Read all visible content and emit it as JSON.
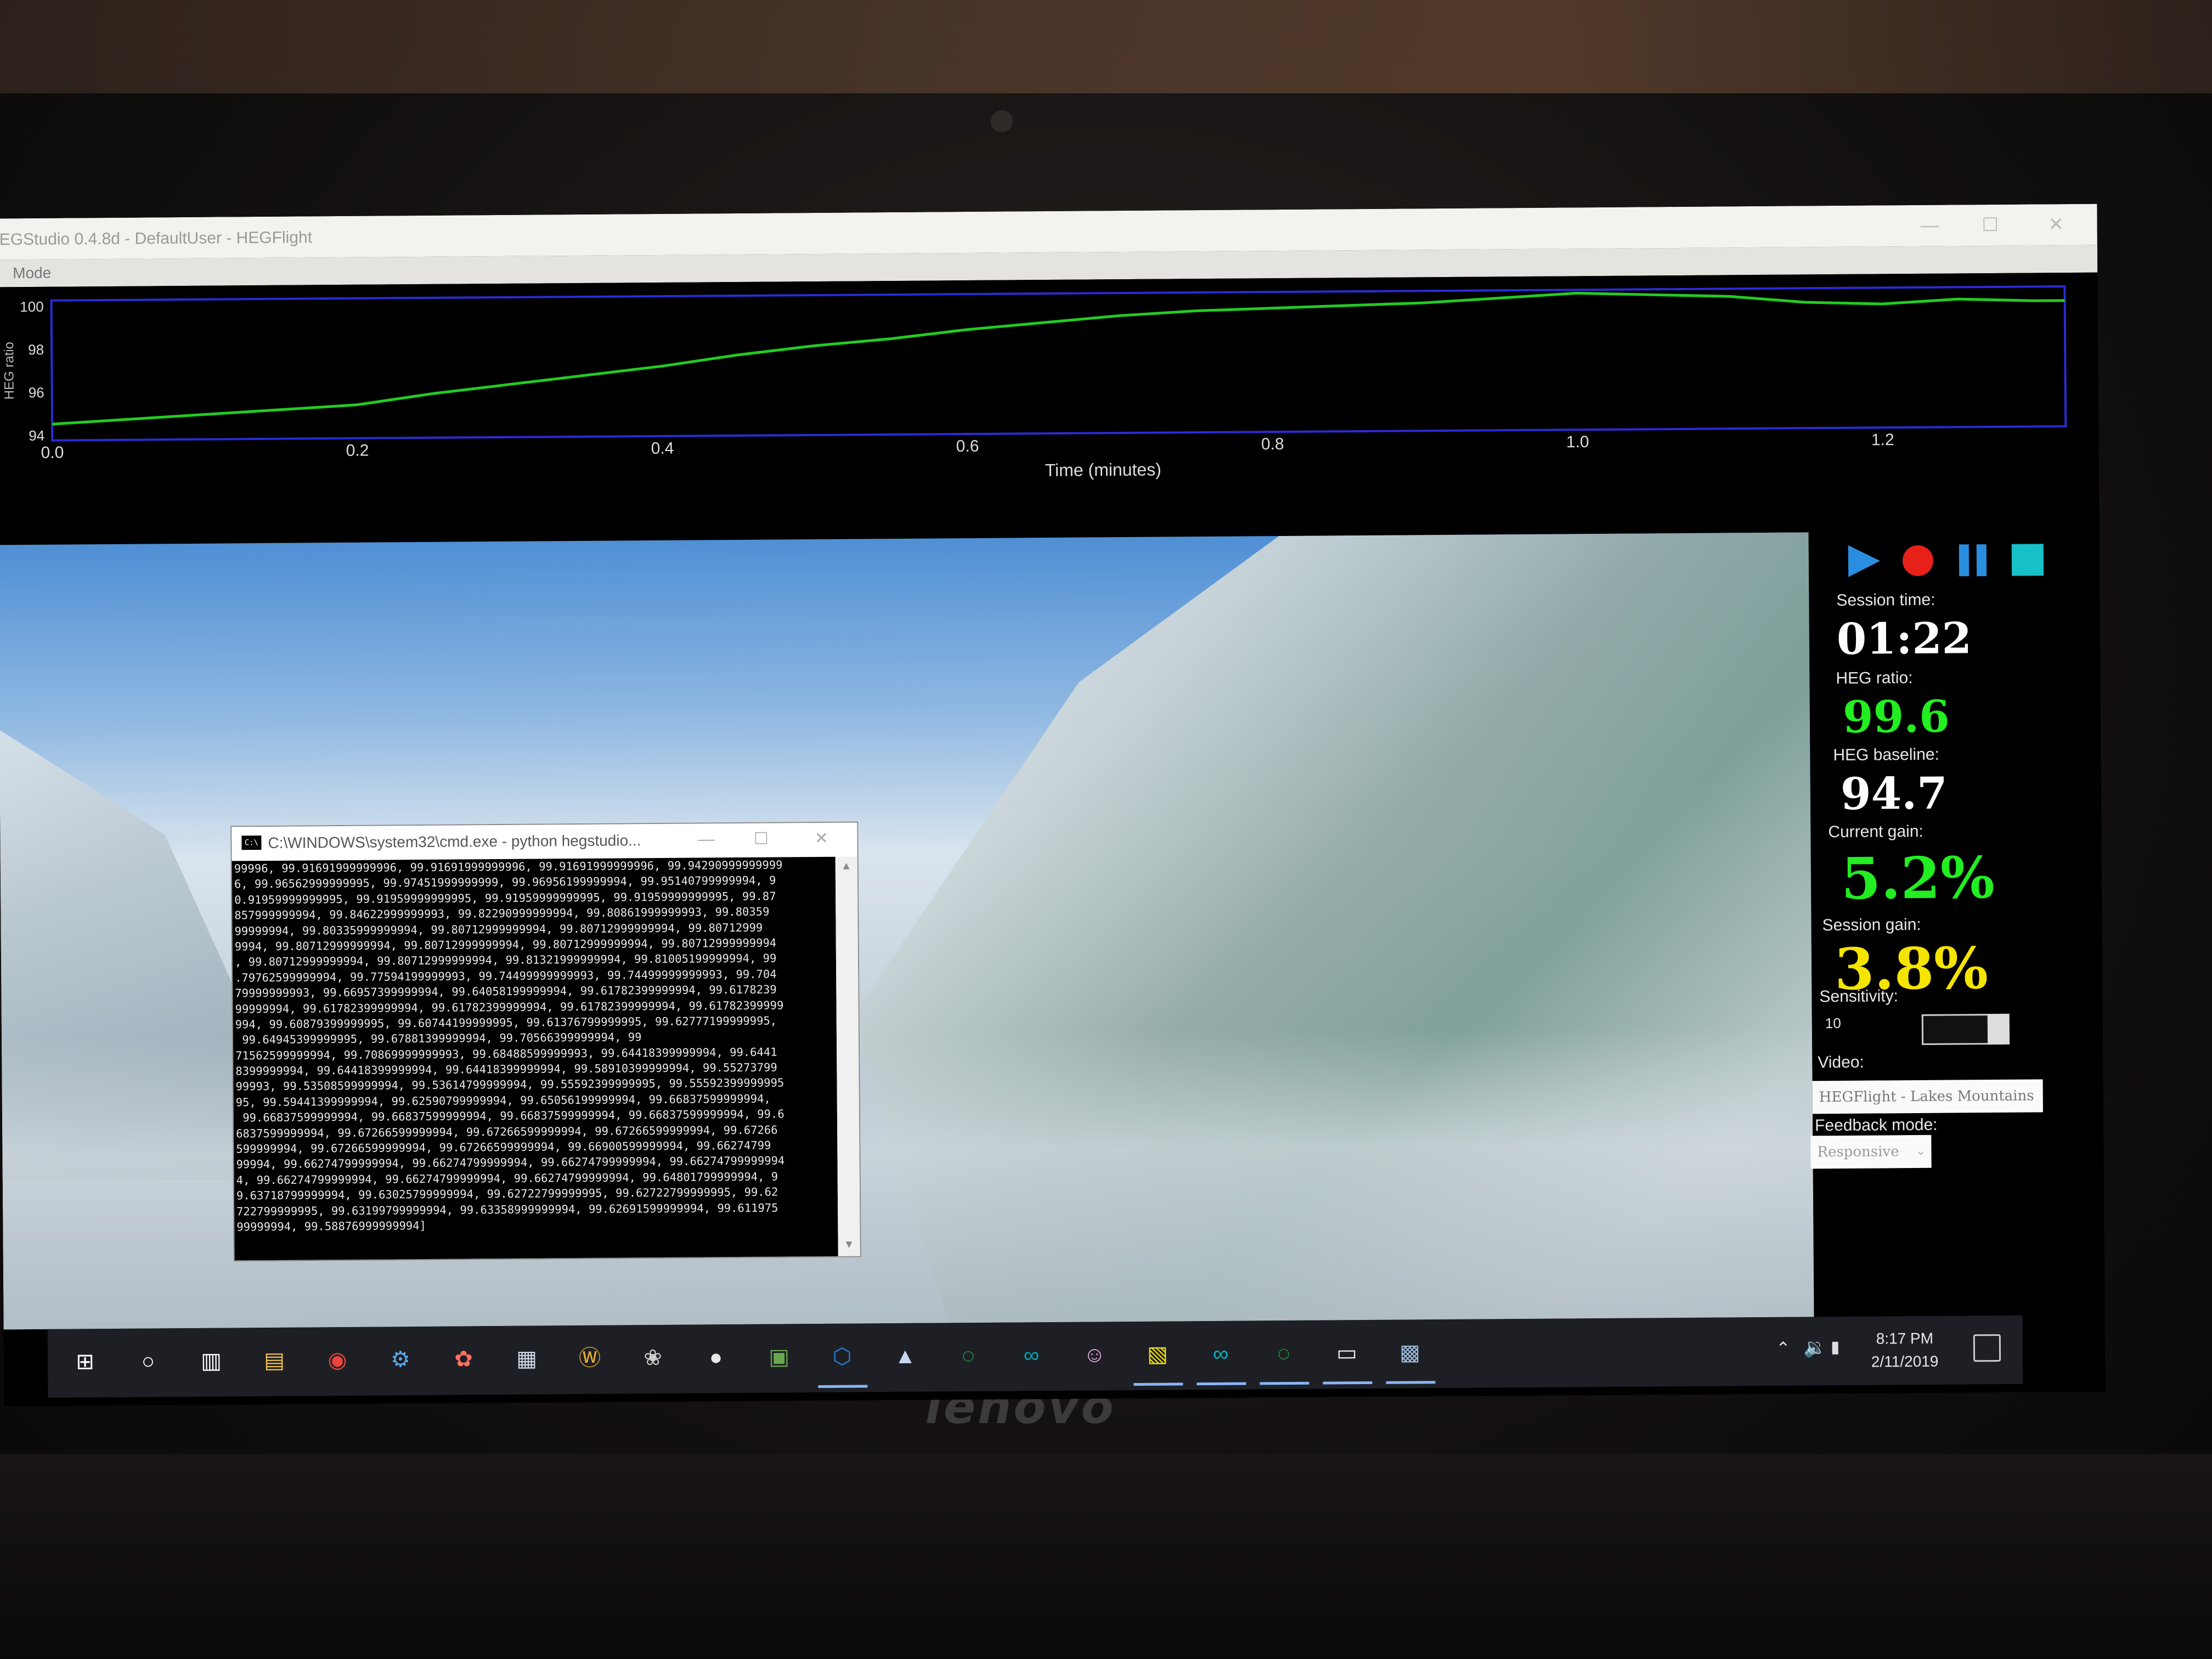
{
  "window": {
    "title": "EGStudio 0.4.8d - DefaultUser - HEGFlight",
    "menu": [
      "Mode"
    ]
  },
  "chart_data": {
    "type": "line",
    "title": "",
    "xlabel": "Time (minutes)",
    "ylabel": "HEG ratio",
    "xlim": [
      0,
      1.32
    ],
    "ylim": [
      94,
      100
    ],
    "x_ticks": [
      "0.0",
      "0.2",
      "0.4",
      "0.6",
      "0.8",
      "1.0",
      "1.2"
    ],
    "y_ticks": [
      "100",
      "98",
      "96",
      "94"
    ],
    "grid": false,
    "series": [
      {
        "color": "#22cc22",
        "x": [
          0.0,
          0.05,
          0.1,
          0.15,
          0.2,
          0.25,
          0.3,
          0.35,
          0.4,
          0.45,
          0.5,
          0.55,
          0.6,
          0.65,
          0.7,
          0.75,
          0.8,
          0.85,
          0.9,
          0.95,
          1.0,
          1.05,
          1.1,
          1.15,
          1.2,
          1.25,
          1.3,
          1.32
        ],
        "y": [
          94.5,
          94.7,
          94.9,
          95.1,
          95.3,
          95.8,
          96.2,
          96.6,
          97.0,
          97.5,
          97.9,
          98.2,
          98.6,
          98.9,
          99.2,
          99.4,
          99.5,
          99.6,
          99.7,
          99.9,
          100.1,
          100.0,
          99.9,
          99.6,
          99.5,
          99.7,
          99.6,
          99.6
        ]
      }
    ]
  },
  "cmd": {
    "title": "C:\\WINDOWS\\system32\\cmd.exe - python  hegstudio...",
    "lines": [
      "99996, 99.91691999999996, 99.91691999999996, 99.91691999999996, 99.94290999999999",
      "6, 99.96562999999995, 99.97451999999999, 99.96956199999994, 99.95140799999994, 9",
      "0.91959999999995, 99.91959999999995, 99.91959999999995, 99.91959999999995, 99.87",
      "857999999994, 99.84622999999993, 99.82290999999994, 99.80861999999993, 99.80359",
      "99999994, 99.80335999999994, 99.80712999999994, 99.80712999999994, 99.80712999",
      "9994, 99.80712999999994, 99.80712999999994, 99.80712999999994, 99.80712999999994",
      ", 99.80712999999994, 99.80712999999994, 99.81321999999994, 99.81005199999994, 99",
      ".79762599999994, 99.77594199999993, 99.74499999999993, 99.74499999999993, 99.704",
      "79999999993, 99.66957399999994, 99.64058199999994, 99.61782399999994, 99.6178239",
      "99999994, 99.61782399999994, 99.61782399999994, 99.61782399999994, 99.61782399999",
      "994, 99.60879399999995, 99.60744199999995, 99.61376799999995, 99.62777199999995,",
      " 99.64945399999995, 99.67881399999994, 99.70566399999994, 99",
      "71562599999994, 99.70869999999993, 99.68488599999993, 99.64418399999994, 99.6441",
      "8399999994, 99.64418399999994, 99.64418399999994, 99.58910399999994, 99.55273799",
      "99993, 99.53508599999994, 99.53614799999994, 99.55592399999995, 99.55592399999995",
      "95, 99.59441399999994, 99.62590799999994, 99.65056199999994, 99.66837599999994,",
      " 99.66837599999994, 99.66837599999994, 99.66837599999994, 99.66837599999994, 99.6",
      "6837599999994, 99.67266599999994, 99.67266599999994, 99.67266599999994, 99.67266",
      "599999994, 99.67266599999994, 99.67266599999994, 99.66900599999994, 99.66274799",
      "99994, 99.66274799999994, 99.66274799999994, 99.66274799999994, 99.66274799999994",
      "4, 99.66274799999994, 99.66274799999994, 99.66274799999994, 99.64801799999994, 9",
      "9.63718799999994, 99.63025799999994, 99.62722799999995, 99.62722799999995, 99.62",
      "722799999995, 99.63199799999994, 99.63358999999994, 99.62691599999994, 99.611975",
      "99999994, 99.58876999999994]"
    ]
  },
  "panel": {
    "session_time_label": "Session time:",
    "session_time": "01:22",
    "heg_ratio_label": "HEG ratio:",
    "heg_ratio": "99.6",
    "heg_baseline_label": "HEG baseline:",
    "heg_baseline": "94.7",
    "current_gain_label": "Current gain:",
    "current_gain": "5.2%",
    "session_gain_label": "Session gain:",
    "session_gain": "3.8%",
    "sensitivity_label": "Sensitivity:",
    "sensitivity": "10",
    "video_label": "Video:",
    "video": "HEGFlight - Lakes Mountains",
    "feedback_label": "Feedback mode:",
    "feedback": "Responsive"
  },
  "colors": {
    "ratio_green": "#22ee22",
    "session_gain_yellow": "#f5e400",
    "chart_border": "#2b2bd6",
    "play_blue": "#2a8ee0",
    "record_red": "#e8201a",
    "stop_cyan": "#18c0c8"
  },
  "taskbar": {
    "icons": [
      "windows-start-icon",
      "cortana-search-icon",
      "task-view-icon",
      "file-explorer-icon",
      "chrome-icon",
      "steam-icon",
      "paint-icon",
      "notepad-icon",
      "app-icon",
      "butterfly-app-icon",
      "browser-icon",
      "minecraft-icon",
      "vscode-icon",
      "3d-app-icon",
      "green-ring-app-icon",
      "arduino-icon",
      "github-icon",
      "sticky-notes-icon",
      "arduino-ide-icon",
      "green-ring-app-icon-2",
      "cmd-icon",
      "hegstudio-icon"
    ],
    "time": "8:17 PM",
    "date": "2/11/2019"
  },
  "device": {
    "brand": "lenovo"
  }
}
